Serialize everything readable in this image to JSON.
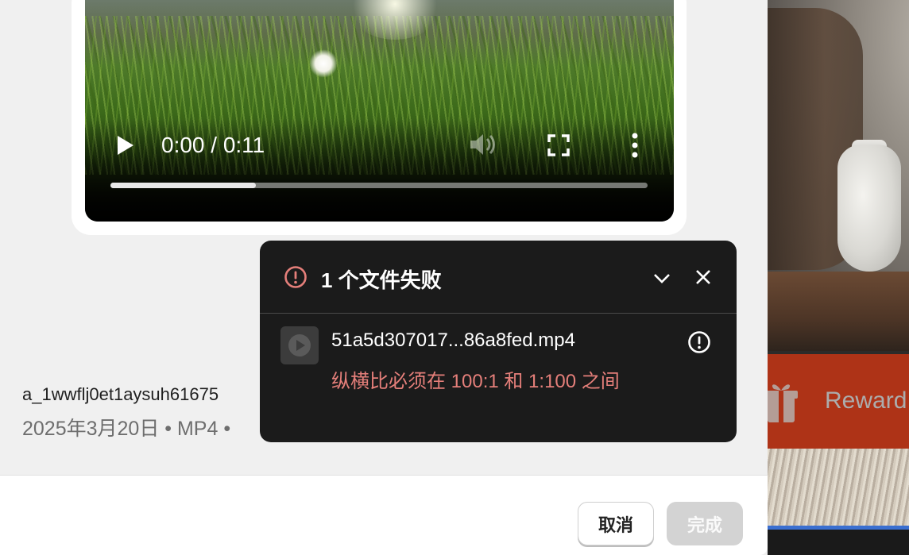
{
  "video": {
    "time_display": "0:00 / 0:11",
    "progress": 0.27,
    "icons": [
      "play-icon",
      "volume-muted-icon",
      "fullscreen-icon",
      "more-vertical-icon"
    ]
  },
  "file": {
    "name": "a_1wwflj0et1aysuh61675",
    "meta": "2025年3月20日 • MP4 •"
  },
  "toast": {
    "title": "1 个文件失败",
    "items": [
      {
        "name": "51a5d307017...86a8fed.mp4",
        "error": "纵横比必须在 100:1 和 1:100 之间"
      }
    ],
    "error_color": "#e57f7a"
  },
  "footer": {
    "cancel_label": "取消",
    "done_label": "完成"
  },
  "background": {
    "reward_label": "Reward",
    "reward_color": "#e8441f"
  }
}
